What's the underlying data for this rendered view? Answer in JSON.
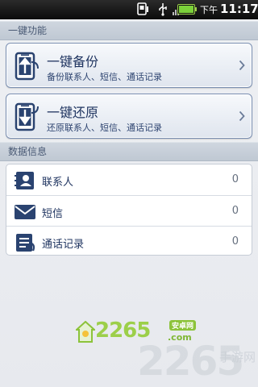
{
  "status_bar": {
    "ampm": "下午",
    "time": "11:17",
    "icons": [
      "phone-icon",
      "usb-icon",
      "signal-icon",
      "battery-icon"
    ]
  },
  "sections": {
    "one_key": "一键功能",
    "data_info": "数据信息"
  },
  "actions": [
    {
      "title": "一键备份",
      "subtitle": "备份联系人、短信、通话记录",
      "icon": "backup-phone-icon"
    },
    {
      "title": "一键还原",
      "subtitle": "还原联系人、短信、通话记录",
      "icon": "restore-phone-icon"
    }
  ],
  "data_items": [
    {
      "label": "联系人",
      "count": "0",
      "icon": "contacts-icon"
    },
    {
      "label": "短信",
      "count": "0",
      "icon": "sms-icon"
    },
    {
      "label": "通话记录",
      "count": "0",
      "icon": "call-log-icon"
    }
  ],
  "watermarks": {
    "small_logo_text": "2265",
    "small_logo_badge": "安卓网",
    "small_logo_domain": ".com",
    "large_logo_text": "2265",
    "large_logo_sub": "手游网"
  },
  "colors": {
    "accent": "#2b3f66",
    "card_border": "#7a8fb2",
    "section_header": "#c8d0da"
  }
}
